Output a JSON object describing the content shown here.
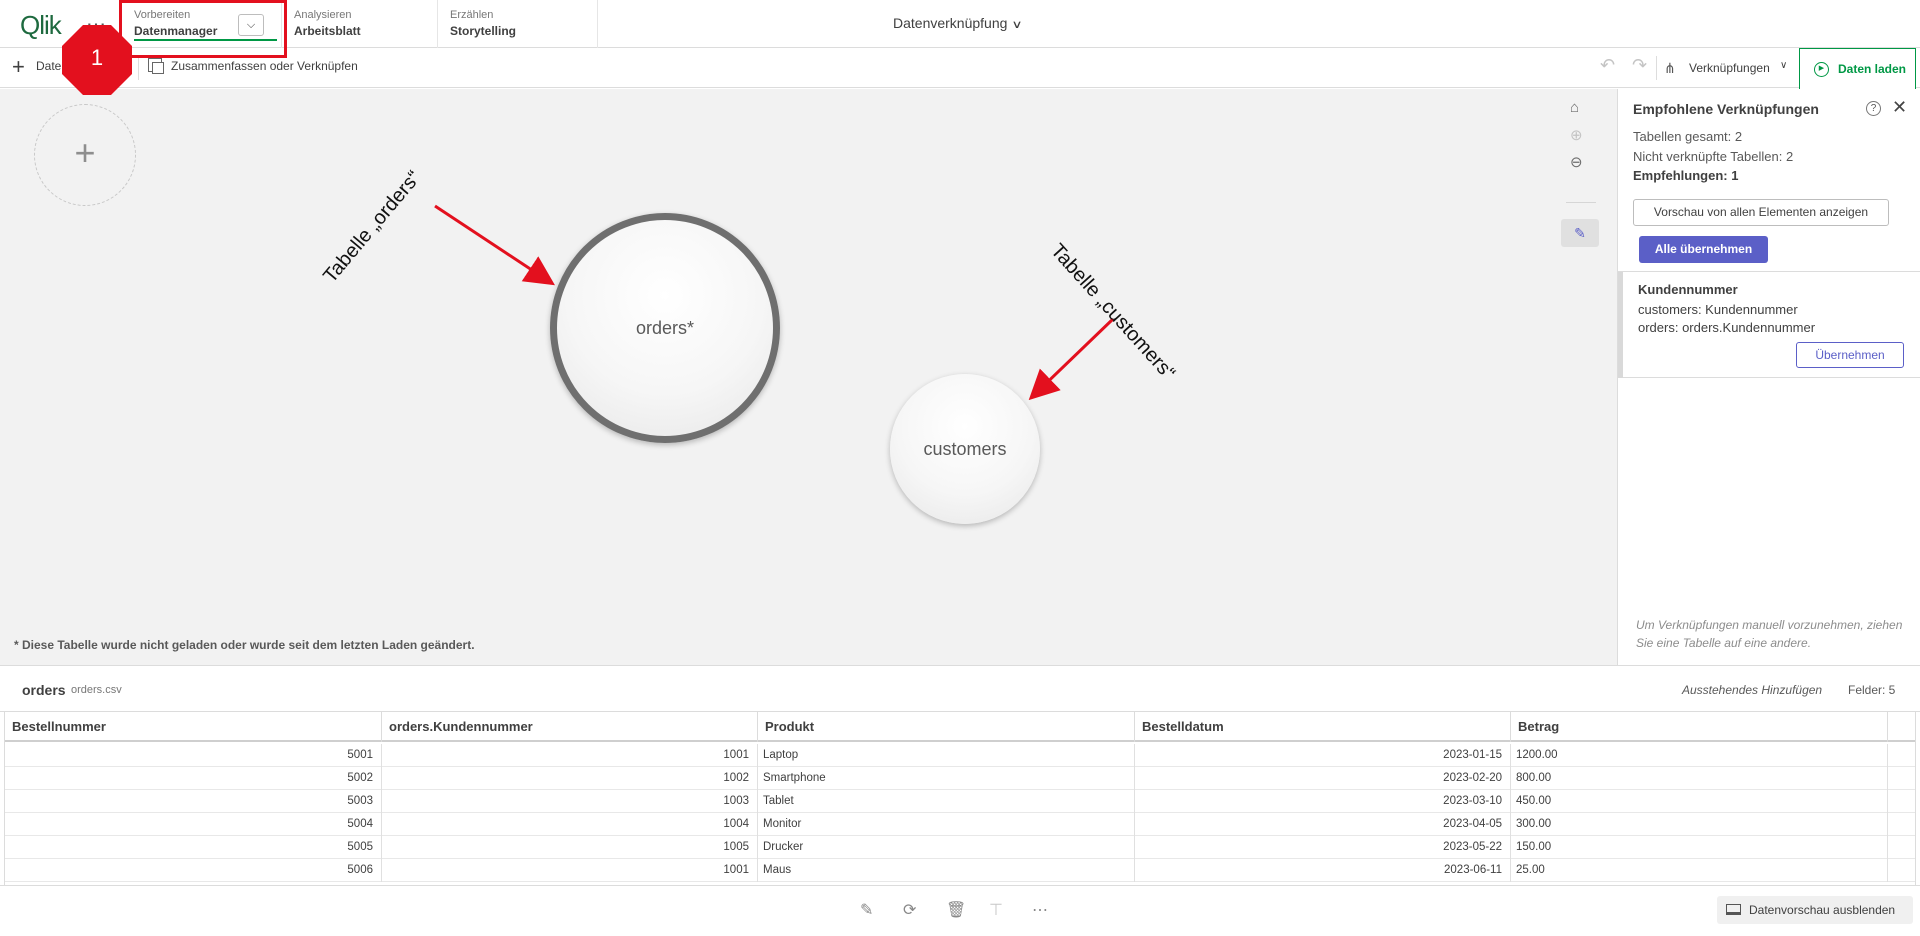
{
  "header": {
    "logo": "Qlik",
    "menu_icon": "ellipsis-icon",
    "tabs": [
      {
        "small": "Vorbereiten",
        "big": "Datenmanager"
      },
      {
        "small": "Analysieren",
        "big": "Arbeitsblatt"
      },
      {
        "small": "Erzählen",
        "big": "Storytelling"
      }
    ],
    "title": "Datenverknüpfung",
    "highlight_color": "#e3101e"
  },
  "badge": {
    "number": "1"
  },
  "toolbar": {
    "add_data_label": "Daten",
    "merge_label": "Zusammenfassen oder Verknüpfen",
    "links_label": "Verknüpfungen",
    "load_label": "Daten laden",
    "accent_color": "#009845"
  },
  "canvas": {
    "orders_bubble": "orders*",
    "customers_bubble": "customers",
    "note": "* Diese Tabelle wurde nicht geladen oder wurde seit dem letzten Laden geändert.",
    "annotation_orders": "Tabelle „orders“",
    "annotation_customers": "Tabelle „customers“"
  },
  "panel": {
    "title": "Empfohlene Verknüpfungen",
    "total_tables": "Tabellen gesamt: 2",
    "unlinked_tables": "Nicht verknüpfte Tabellen: 2",
    "recommendations": "Empfehlungen: 1",
    "preview_all": "Vorschau von allen Elementen anzeigen",
    "apply_all": "Alle übernehmen",
    "recommendation": {
      "field": "Kundennummer",
      "line1": "customers: Kundennummer",
      "line2": "orders: orders.Kundennummer",
      "apply": "Übernehmen"
    },
    "hint": "Um Verknüpfungen manuell vorzunehmen, ziehen Sie eine Tabelle auf eine andere.",
    "accent_color": "#5b5fc7"
  },
  "preview": {
    "table_name": "orders",
    "file_name": "orders.csv",
    "status": "Ausstehendes Hinzufügen",
    "fields": "Felder: 5",
    "columns": [
      "Bestellnummer",
      "orders.Kundennummer",
      "Produkt",
      "Bestelldatum",
      "Betrag"
    ],
    "rows": [
      [
        "5001",
        "1001",
        "Laptop",
        "2023-01-15",
        "1200.00"
      ],
      [
        "5002",
        "1002",
        "Smartphone",
        "2023-02-20",
        "800.00"
      ],
      [
        "5003",
        "1003",
        "Tablet",
        "2023-03-10",
        "450.00"
      ],
      [
        "5004",
        "1004",
        "Monitor",
        "2023-04-05",
        "300.00"
      ],
      [
        "5005",
        "1005",
        "Drucker",
        "2023-05-22",
        "150.00"
      ],
      [
        "5006",
        "1001",
        "Maus",
        "2023-06-11",
        "25.00"
      ]
    ]
  },
  "bottombar": {
    "hide_preview": "Datenvorschau ausblenden"
  }
}
